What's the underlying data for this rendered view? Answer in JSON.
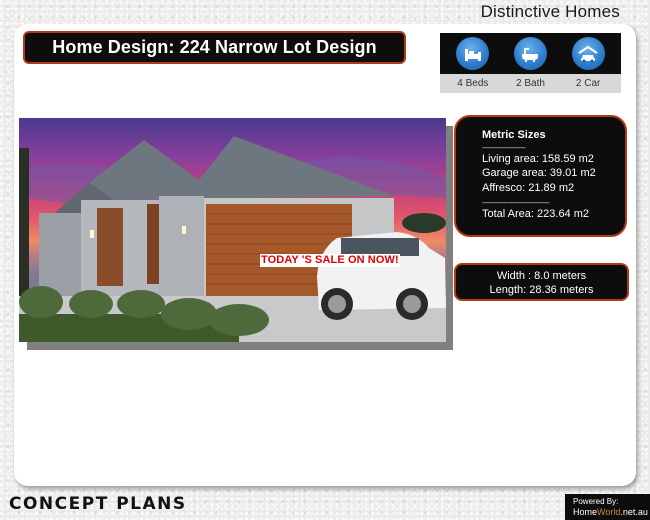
{
  "brand": "Distinctive Homes",
  "title": "Home Design: 224 Narrow  Lot Design",
  "features": [
    {
      "icon": "bed-icon",
      "label": "4 Beds"
    },
    {
      "icon": "bath-icon",
      "label": "2 Bath"
    },
    {
      "icon": "car-icon",
      "label": "2 Car"
    }
  ],
  "photo": {
    "alt": "Rendering of single-storey home with timber garage door and white SUV at dusk",
    "sale_badge": "TODAY 'S SALE ON NOW!"
  },
  "metric": {
    "heading": "Metric Sizes",
    "divider": "--------------------",
    "living": "Living area: 158.59 m2",
    "garage": "Garage area: 39.01 m2",
    "affresco": "Affresco: 21.89 m2",
    "divider2": "-------------------------------",
    "total": "Total Area: 223.64 m2"
  },
  "dimensions": {
    "width": "Width : 8.0 meters",
    "length": "Length: 28.36 meters"
  },
  "footer": {
    "logo": "CONCEPT PLANS",
    "powered_by": "Powered By:",
    "site_a": "Home",
    "site_b": "World",
    "site_c": ".net.au"
  },
  "colors": {
    "accent_border": "#b13a1a",
    "icon_blue": "#2f7fce",
    "sale_red": "#e00000"
  }
}
